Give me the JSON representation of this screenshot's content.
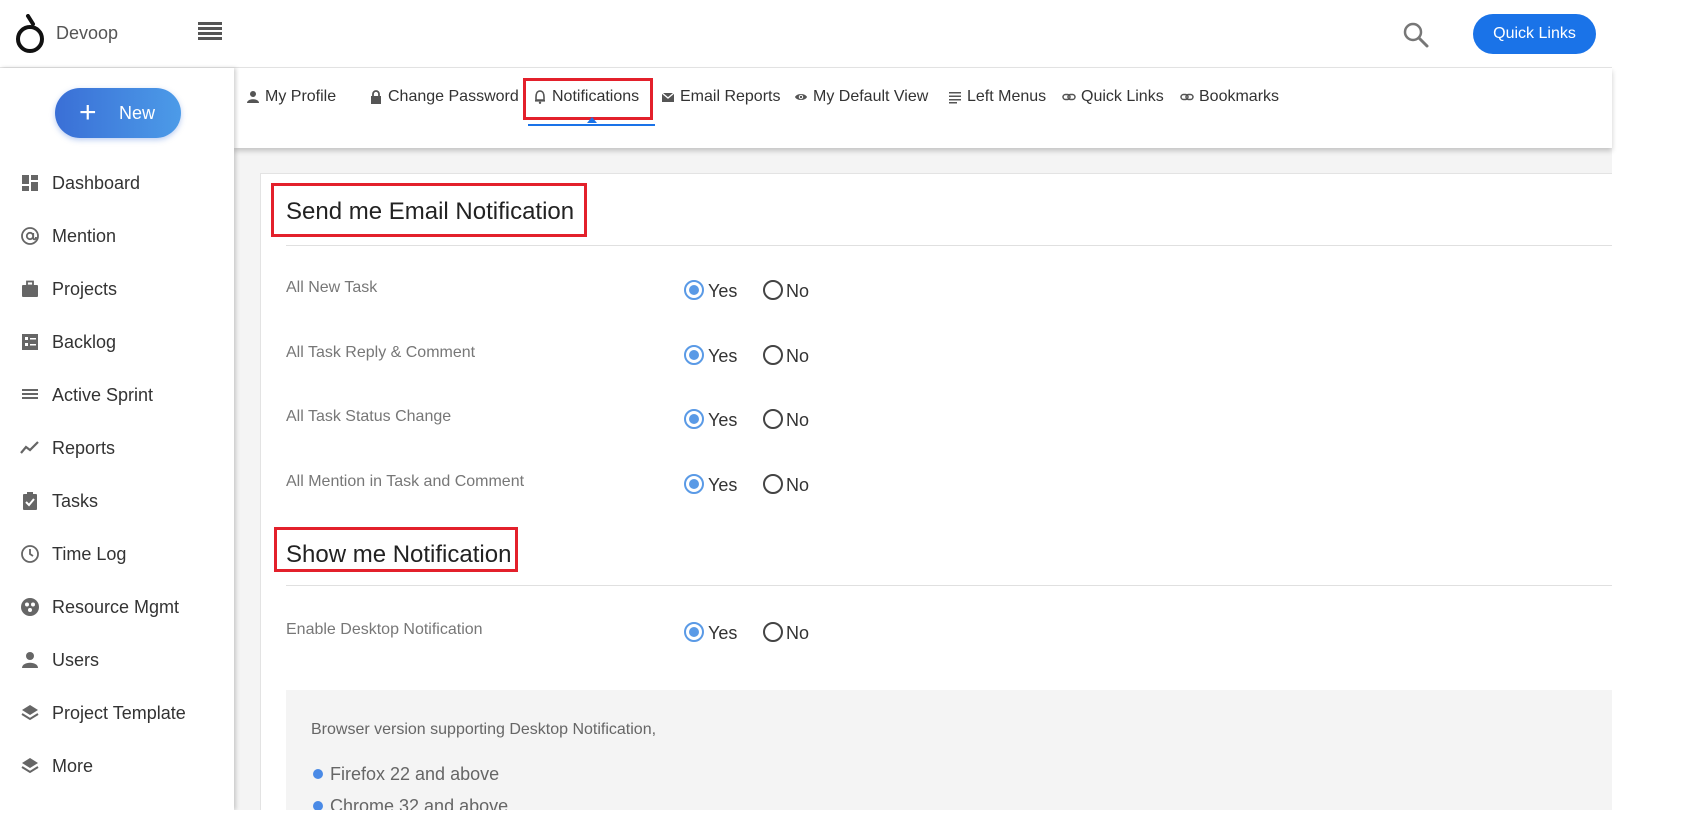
{
  "app": {
    "name": "Devoop"
  },
  "topbar": {
    "quick_links_label": "Quick Links"
  },
  "sidebar": {
    "new_label": "New",
    "items": [
      {
        "label": "Dashboard",
        "icon": "dashboard-icon"
      },
      {
        "label": "Mention",
        "icon": "at-icon"
      },
      {
        "label": "Projects",
        "icon": "briefcase-icon"
      },
      {
        "label": "Backlog",
        "icon": "backlog-icon"
      },
      {
        "label": "Active Sprint",
        "icon": "sprint-icon"
      },
      {
        "label": "Reports",
        "icon": "trend-icon"
      },
      {
        "label": "Tasks",
        "icon": "clipboard-check-icon"
      },
      {
        "label": "Time Log",
        "icon": "clock-icon"
      },
      {
        "label": "Resource Mgmt",
        "icon": "resource-icon"
      },
      {
        "label": "Users",
        "icon": "user-icon"
      },
      {
        "label": "Project Template",
        "icon": "layers-icon"
      },
      {
        "label": "More",
        "icon": "layers-icon"
      }
    ]
  },
  "tabs": [
    {
      "label": "My Profile",
      "icon": "person-icon"
    },
    {
      "label": "Change Password",
      "icon": "lock-icon"
    },
    {
      "label": "Notifications",
      "icon": "bell-icon",
      "active": true
    },
    {
      "label": "Email Reports",
      "icon": "mail-icon"
    },
    {
      "label": "My Default View",
      "icon": "eye-icon"
    },
    {
      "label": "Left Menus",
      "icon": "list-icon"
    },
    {
      "label": "Quick Links",
      "icon": "link-icon"
    },
    {
      "label": "Bookmarks",
      "icon": "link-icon"
    }
  ],
  "email_section": {
    "title": "Send me Email Notification",
    "rows": [
      {
        "label": "All New Task",
        "value": "Yes"
      },
      {
        "label": "All Task Reply & Comment",
        "value": "Yes"
      },
      {
        "label": "All Task Status Change",
        "value": "Yes"
      },
      {
        "label": "All Mention in Task and Comment",
        "value": "Yes"
      }
    ]
  },
  "show_section": {
    "title": "Show me Notification",
    "rows": [
      {
        "label": "Enable Desktop Notification",
        "value": "Yes"
      }
    ]
  },
  "options": {
    "yes": "Yes",
    "no": "No"
  },
  "info": {
    "title": "Browser version supporting Desktop Notification,",
    "items": [
      "Firefox 22 and above",
      "Chrome 32 and above"
    ]
  },
  "colors": {
    "accent": "#1a73e8",
    "highlight": "#e3202b",
    "radio": "#5a9ae6"
  }
}
